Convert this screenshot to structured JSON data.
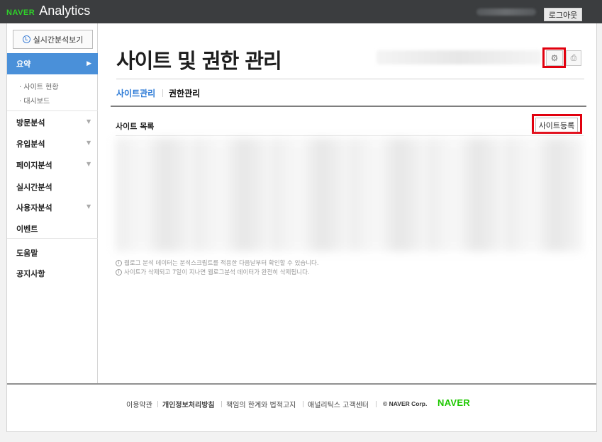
{
  "topbar": {
    "logo_brand": "NAVER",
    "logo_product": "Analytics",
    "logout_label": "로그아웃"
  },
  "sidebar": {
    "realtime_button": "실시간분석보기",
    "active_item": "요약",
    "sub_items": [
      "· 사이트 현황",
      "· 대시보드"
    ],
    "items": [
      "방문분석",
      "유입분석",
      "페이지분석",
      "실시간분석",
      "사용자분석",
      "이벤트",
      "도움말",
      "공지사항"
    ]
  },
  "main": {
    "page_title": "사이트 및 권한 관리",
    "tabs": [
      "사이트관리",
      "권한관리"
    ],
    "list_title": "사이트 목록",
    "register_button": "사이트등록",
    "notes": [
      "웹로그 분석 데이터는 분석스크립트를 적용한 다음날부터 확인할 수 있습니다.",
      "사이트가 삭제되고 7일이 지나면 웹로그분석 데이터가 완전히 삭제됩니다."
    ]
  },
  "footer": {
    "links": [
      "이용약관",
      "개인정보처리방침",
      "책임의 한계와 법적고지",
      "애널리틱스 고객센터"
    ],
    "copyright": "© NAVER Corp.",
    "brand": "NAVER"
  },
  "colors": {
    "accent": "#4a90d9",
    "brand_green": "#1ec800",
    "highlight": "#e1000e",
    "topbar": "#3b3d3f"
  },
  "icons": {
    "clock": "clock-icon",
    "settings": "gear-icon",
    "print": "print-icon",
    "info": "info-icon"
  }
}
